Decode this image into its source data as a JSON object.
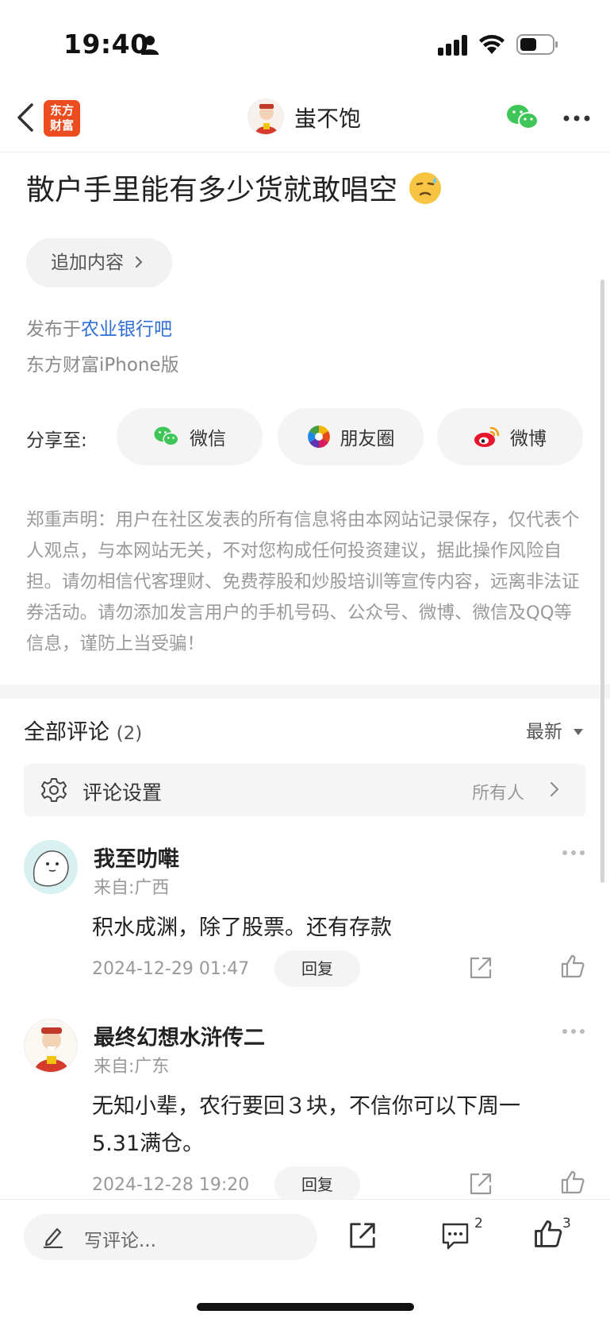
{
  "status_bar": {
    "time": "19:40"
  },
  "nav": {
    "logo_line1": "东方",
    "logo_line2": "财富",
    "forum_name": "蚩不饱"
  },
  "post": {
    "title": "散户手里能有多少货就敢唱空",
    "append_label": "追加内容",
    "published_prefix": "发布于",
    "published_forum": "农业银行吧",
    "client": "东方财富iPhone版",
    "share_label": "分享至:",
    "share_wechat": "微信",
    "share_moments": "朋友圈",
    "share_weibo": "微博",
    "disclaimer": "郑重声明：用户在社区发表的所有信息将由本网站记录保存，仅代表个人观点，与本网站无关，不对您构成任何投资建议，据此操作风险自担。请勿相信代客理财、免费荐股和炒股培训等宣传内容，远离非法证券活动。请勿添加发言用户的手机号码、公众号、微博、微信及QQ等信息，谨防上当受骗！"
  },
  "comments": {
    "header": "全部评论",
    "count": "(2)",
    "sort": "最新",
    "settings_label": "评论设置",
    "settings_value": "所有人",
    "items": [
      {
        "name": "我至叻嚡",
        "location": "来自:广西",
        "text": "积水成渊，除了股票。还有存款",
        "date": "2024-12-29 01:47",
        "reply": "回复"
      },
      {
        "name": "最终幻想水浒传二",
        "location": "来自:广东",
        "text": "无知小辈，农行要回３块，不信你可以下周一5.31满仓。",
        "date": "2024-12-28 19:20",
        "reply": "回复"
      }
    ]
  },
  "bottom_bar": {
    "write_placeholder": "写评论...",
    "comment_count": "2",
    "like_count": "3"
  },
  "colors": {
    "accent_blue": "#2f6fd6",
    "brand_orange": "#ec4d1f",
    "wechat_green": "#3fc659"
  }
}
